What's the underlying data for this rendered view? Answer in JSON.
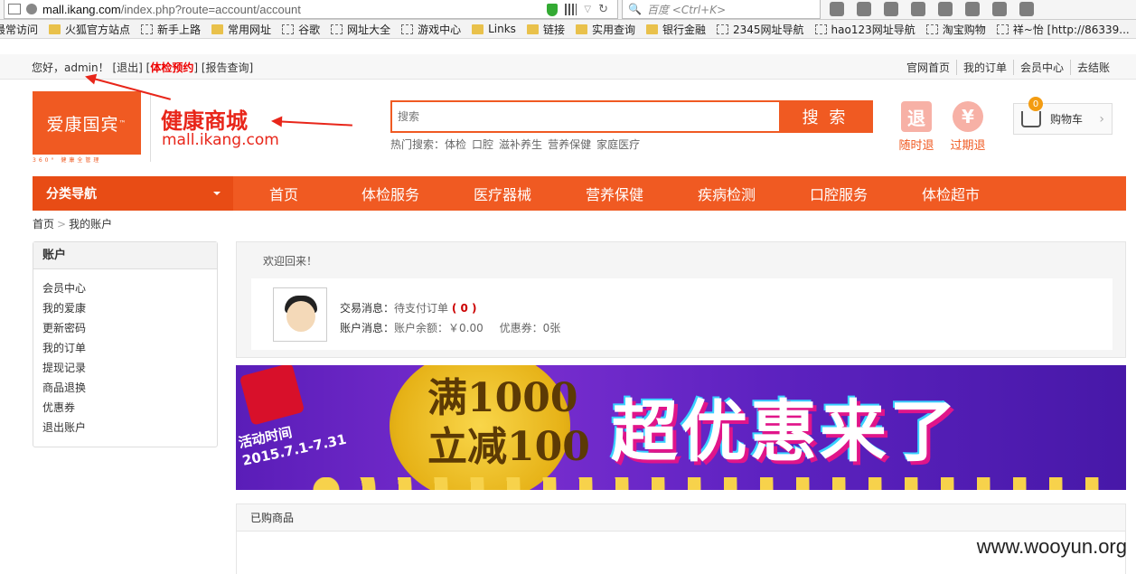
{
  "browser": {
    "url_host": "mall.ikang.com",
    "url_path": "/index.php?route=account/account",
    "search_placeholder": "百度 <Ctrl+K>"
  },
  "bookmarks": [
    {
      "label": "最常访问",
      "type": "page"
    },
    {
      "label": "火狐官方站点",
      "type": "folder"
    },
    {
      "label": "新手上路",
      "type": "page"
    },
    {
      "label": "常用网址",
      "type": "folder"
    },
    {
      "label": "谷歌",
      "type": "page"
    },
    {
      "label": "网址大全",
      "type": "page"
    },
    {
      "label": "游戏中心",
      "type": "page"
    },
    {
      "label": "Links",
      "type": "folder"
    },
    {
      "label": "链接",
      "type": "folder"
    },
    {
      "label": "实用查询",
      "type": "folder"
    },
    {
      "label": "银行金融",
      "type": "folder"
    },
    {
      "label": "2345网址导航",
      "type": "page"
    },
    {
      "label": "hao123网址导航",
      "type": "page"
    },
    {
      "label": "淘宝购物",
      "type": "page"
    },
    {
      "label": "祥~怡 [http://86339...",
      "type": "page"
    }
  ],
  "topbar": {
    "greeting": "您好，admin！",
    "logout": "[退出]",
    "checkup_prefix": "[",
    "checkup": "体检预约",
    "checkup_suffix": "]",
    "report": "[报告查询]",
    "links": [
      "官网首页",
      "我的订单",
      "会员中心",
      "去结账"
    ]
  },
  "header": {
    "logo_text": "爱康国宾",
    "logo_tm": "™",
    "logo_sub": "360° 健康全管理",
    "mall_name": "健康商城",
    "mall_url": "mall.ikang.com",
    "search_placeholder": "搜索",
    "search_button": "搜 索",
    "hot_label": "热门搜索：",
    "hot_terms": [
      "体检",
      "口腔",
      "滋补养生",
      "营养保健",
      "家庭医疗"
    ],
    "service1_icon": "退",
    "service1": "随时退",
    "service2_icon": "¥",
    "service2": "过期退",
    "cart_label": "购物车",
    "cart_count": "0"
  },
  "nav": {
    "category": "分类导航",
    "items": [
      "首页",
      "体检服务",
      "医疗器械",
      "营养保健",
      "疾病检测",
      "口腔服务",
      "体检超市"
    ]
  },
  "breadcrumb": {
    "home": "首页",
    "sep": ">",
    "current": "我的账户"
  },
  "sidebar": {
    "title": "账户",
    "items": [
      "会员中心",
      "我的爱康",
      "更新密码",
      "我的订单",
      "提现记录",
      "商品退换",
      "优惠券",
      "退出账户"
    ]
  },
  "account": {
    "welcome": "欢迎回来！",
    "trade_label": "交易消息：",
    "trade_text": "待支付订单",
    "trade_count": "( 0 )",
    "account_label": "账户消息：",
    "balance": "账户余额：￥0.00",
    "coupon": "优惠券：0张"
  },
  "banner": {
    "date_label": "活动时间",
    "date_range": "2015.7.1-7.31",
    "promo_line1": "满1000",
    "promo_line2": "立减100",
    "headline": "超优惠来了"
  },
  "purchased": {
    "title": "已购商品"
  },
  "watermark": "www.wooyun.org",
  "colors": {
    "brand": "#f05a22",
    "accent_red": "#e8261a"
  }
}
